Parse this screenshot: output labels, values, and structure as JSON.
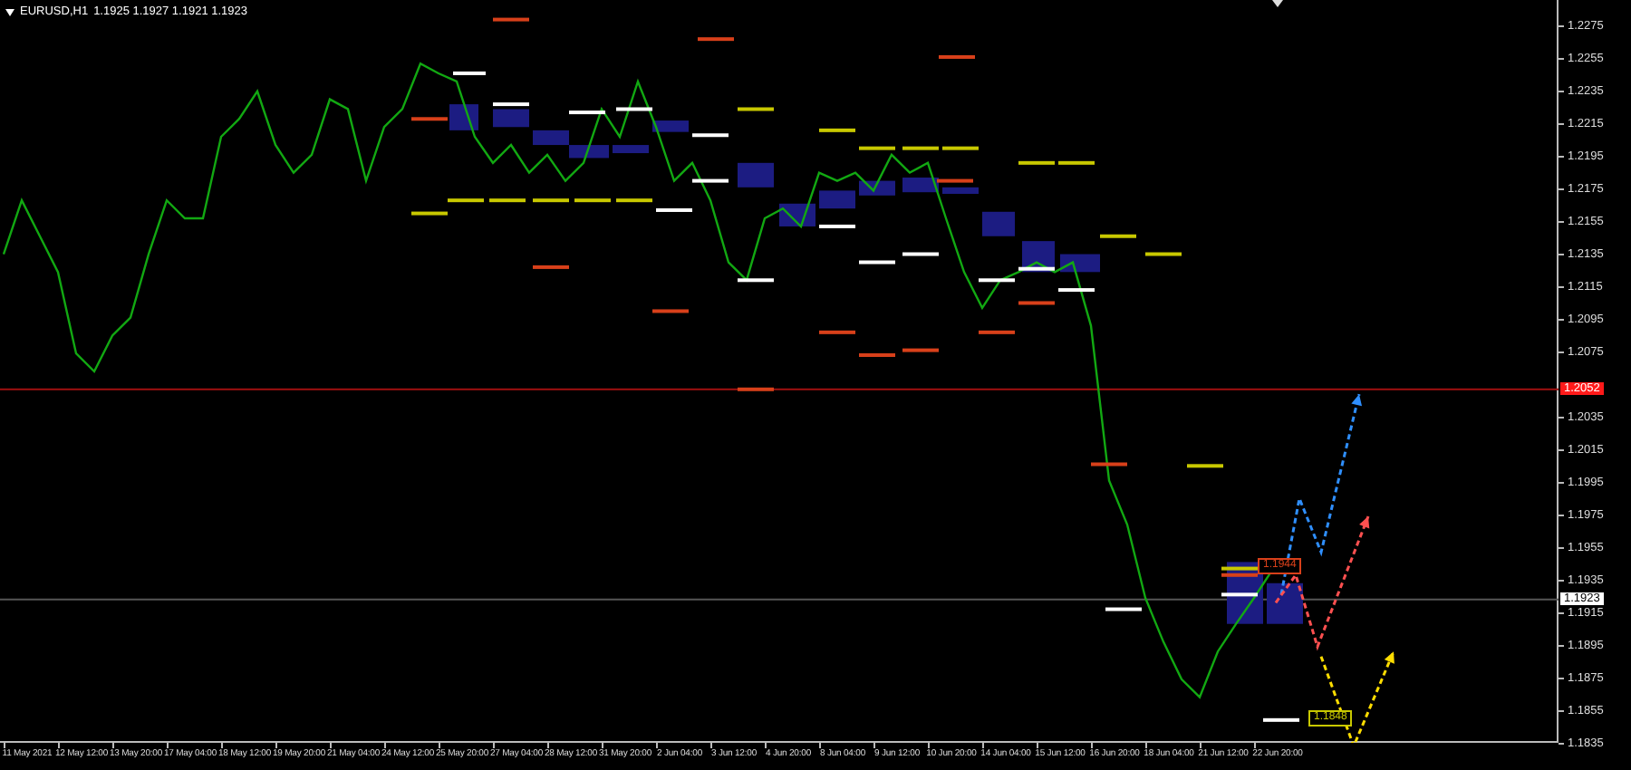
{
  "chart": {
    "header": {
      "symbol": "EURUSD,H1",
      "ohlc": "1.1925 1.1927 1.1921 1.1923"
    },
    "chart_data": {
      "type": "line",
      "categories": [
        null,
        "11 May 2021",
        null,
        null,
        "12 May 12:00",
        null,
        null,
        "13 May 20:00",
        null,
        null,
        "17 May 04:00",
        null,
        null,
        "18 May 12:00",
        null,
        null,
        "19 May 20:00",
        null,
        null,
        "21 May 04:00",
        null,
        null,
        "24 May 12:00",
        null,
        null,
        "25 May 20:00",
        null,
        null,
        "27 May 04:00",
        null,
        null,
        "28 May 12:00",
        null,
        null,
        "31 May 20:00",
        null,
        null,
        "2 Jun 04:00",
        null,
        null,
        "3 Jun 12:00",
        null,
        null,
        "4 Jun 20:00",
        null,
        null,
        "8 Jun 04:00",
        null,
        null,
        "9 Jun 12:00",
        null,
        null,
        "10 Jun 20:00",
        null,
        null,
        "14 Jun 04:00",
        null,
        null,
        "15 Jun 12:00",
        null,
        null,
        "16 Jun 20:00",
        null,
        null,
        "18 Jun 04:00",
        null,
        null,
        "21 Jun 12:00",
        null,
        null,
        "22 Jun 20:00"
      ],
      "series": [
        {
          "color": "#12a812",
          "values": [
            1.2135,
            1.2168,
            1.2146,
            1.2124,
            1.2074,
            1.2063,
            1.2085,
            1.2096,
            1.2135,
            1.2168,
            1.2157,
            1.2157,
            1.2207,
            1.2218,
            1.2235,
            1.2202,
            1.2185,
            1.2196,
            1.223,
            1.2224,
            1.218,
            1.2213,
            1.2224,
            1.2252,
            1.2246,
            1.2241,
            1.2207,
            1.2191,
            1.2202,
            1.2185,
            1.2196,
            1.218,
            1.2191,
            1.2224,
            1.2207,
            1.2241,
            1.2213,
            1.218,
            1.2191,
            1.2168,
            1.213,
            1.2119,
            1.2157,
            1.2163,
            1.2152,
            1.2185,
            1.218,
            1.2185,
            1.2174,
            1.2196,
            1.2185,
            1.2191,
            1.2157,
            1.2124,
            1.2102,
            1.2119,
            1.2124,
            1.213,
            1.2124,
            1.213,
            1.2091,
            1.1996,
            1.1969,
            1.1924,
            1.1897,
            1.1874,
            1.1863,
            1.1891,
            1.1908,
            1.1924,
            1.1941
          ]
        }
      ],
      "ylim": [
        1.1835,
        1.2291
      ],
      "ref_lines": [
        {
          "axis": "y",
          "value": 1.2052,
          "color": "#a01010",
          "label": "1.2052"
        },
        {
          "axis": "y",
          "value": 1.1923,
          "color": "#555555",
          "label": "1.1923"
        }
      ],
      "yticks": [
        {
          "value": 1.2275,
          "label": "1.2275"
        },
        {
          "value": 1.2255,
          "label": "1.2255"
        },
        {
          "value": 1.2235,
          "label": "1.2235"
        },
        {
          "value": 1.2215,
          "label": "1.2215"
        },
        {
          "value": 1.2195,
          "label": "1.2195"
        },
        {
          "value": 1.2175,
          "label": "1.2175"
        },
        {
          "value": 1.2155,
          "label": "1.2155"
        },
        {
          "value": 1.2135,
          "label": "1.2135"
        },
        {
          "value": 1.2115,
          "label": "1.2115"
        },
        {
          "value": 1.2095,
          "label": "1.2095"
        },
        {
          "value": 1.2075,
          "label": "1.2075"
        },
        {
          "value": 1.2035,
          "label": "1.2035"
        },
        {
          "value": 1.2015,
          "label": "1.2015"
        },
        {
          "value": 1.1995,
          "label": "1.1995"
        },
        {
          "value": 1.1975,
          "label": "1.1975"
        },
        {
          "value": 1.1955,
          "label": "1.1955"
        },
        {
          "value": 1.1935,
          "label": "1.1935"
        },
        {
          "value": 1.1915,
          "label": "1.1915"
        },
        {
          "value": 1.1895,
          "label": "1.1895"
        },
        {
          "value": 1.1875,
          "label": "1.1875"
        },
        {
          "value": 1.1855,
          "label": "1.1855"
        },
        {
          "value": 1.1835,
          "label": "1.1835"
        }
      ]
    },
    "labels": [
      {
        "text": "1.1944",
        "color": "#d8401a"
      },
      {
        "text": "1.1848",
        "color": "#c8c800"
      }
    ]
  }
}
